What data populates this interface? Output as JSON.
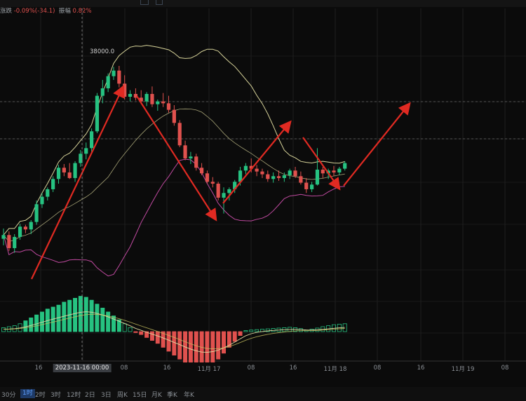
{
  "stats": {
    "change_label": "涨跌",
    "change_value": "-0.09%(-34.1)",
    "amplitude_label": "振幅",
    "amplitude_value": "0.82%"
  },
  "price_marker": "38000.0",
  "x_axis": {
    "ticks": [
      "16",
      "2023-11-16 00:00",
      "08",
      "16",
      "11月 17",
      "08",
      "16",
      "11月 18",
      "08",
      "16",
      "11月 19",
      "08"
    ],
    "highlighted": "2023-11-16 00:00"
  },
  "periods": [
    {
      "label": "30分",
      "active": false
    },
    {
      "label": "1时",
      "active": true
    },
    {
      "label": "2时",
      "active": false
    },
    {
      "label": "3时",
      "active": false
    },
    {
      "label": "12时",
      "active": false
    },
    {
      "label": "2日",
      "active": false
    },
    {
      "label": "3日",
      "active": false
    },
    {
      "label": "周K",
      "active": false
    },
    {
      "label": "15日",
      "active": false
    },
    {
      "label": "月K",
      "active": false
    },
    {
      "label": "季K",
      "active": false
    },
    {
      "label": "年K",
      "active": false
    }
  ],
  "colors": {
    "up": "#26c281",
    "down": "#e0514e",
    "ma": "#d8d49a",
    "boll_upper": "#d8d49a",
    "boll_lower": "#c04aa0",
    "arrow": "#e02a22",
    "dif": "#e0d8a0",
    "dea": "#c8c060"
  },
  "chart_data": {
    "type": "candlestick",
    "interval": "1h",
    "high_marker": 38000.0,
    "candles": [
      [
        36150,
        36260,
        36080,
        36190
      ],
      [
        36190,
        36230,
        36020,
        36050
      ],
      [
        36050,
        36200,
        36000,
        36170
      ],
      [
        36170,
        36310,
        36140,
        36280
      ],
      [
        36280,
        36300,
        36210,
        36250
      ],
      [
        36250,
        36350,
        36200,
        36330
      ],
      [
        36330,
        36560,
        36300,
        36520
      ],
      [
        36520,
        36640,
        36480,
        36600
      ],
      [
        36600,
        36700,
        36560,
        36680
      ],
      [
        36680,
        36820,
        36650,
        36790
      ],
      [
        36790,
        36940,
        36740,
        36910
      ],
      [
        36910,
        36950,
        36820,
        36860
      ],
      [
        36860,
        36960,
        36790,
        36800
      ],
      [
        36800,
        36980,
        36760,
        36960
      ],
      [
        36960,
        37100,
        36920,
        37060
      ],
      [
        37060,
        37180,
        37000,
        37120
      ],
      [
        37120,
        37330,
        37080,
        37300
      ],
      [
        37300,
        37710,
        37280,
        37680
      ],
      [
        37680,
        37850,
        37600,
        37760
      ],
      [
        37760,
        37920,
        37720,
        37890
      ],
      [
        37890,
        37990,
        37850,
        37950
      ],
      [
        37950,
        38000,
        37770,
        37810
      ],
      [
        37810,
        37900,
        37640,
        37670
      ],
      [
        37670,
        37740,
        37620,
        37700
      ],
      [
        37700,
        37760,
        37630,
        37660
      ],
      [
        37660,
        37740,
        37600,
        37620
      ],
      [
        37620,
        37720,
        37570,
        37700
      ],
      [
        37700,
        37780,
        37560,
        37590
      ],
      [
        37590,
        37640,
        37520,
        37620
      ],
      [
        37620,
        37710,
        37560,
        37600
      ],
      [
        37600,
        37680,
        37500,
        37530
      ],
      [
        37530,
        37580,
        37360,
        37390
      ],
      [
        37390,
        37420,
        37130,
        37150
      ],
      [
        37150,
        37200,
        36990,
        37010
      ],
      [
        37010,
        37080,
        36950,
        37030
      ],
      [
        37030,
        37060,
        36880,
        36910
      ],
      [
        36910,
        36960,
        36830,
        36850
      ],
      [
        36850,
        36880,
        36740,
        36760
      ],
      [
        36760,
        36810,
        36700,
        36740
      ],
      [
        36740,
        36760,
        36560,
        36590
      ],
      [
        36590,
        36700,
        36420,
        36640
      ],
      [
        36640,
        36700,
        36560,
        36680
      ],
      [
        36680,
        36780,
        36640,
        36760
      ],
      [
        36760,
        36920,
        36720,
        36880
      ],
      [
        36880,
        36960,
        36840,
        36930
      ],
      [
        36930,
        37010,
        36860,
        36900
      ],
      [
        36900,
        36940,
        36820,
        36870
      ],
      [
        36870,
        36900,
        36800,
        36840
      ],
      [
        36840,
        36880,
        36760,
        36790
      ],
      [
        36790,
        36860,
        36750,
        36820
      ],
      [
        36820,
        36880,
        36770,
        36800
      ],
      [
        36800,
        36860,
        36760,
        36830
      ],
      [
        36830,
        36900,
        36790,
        36880
      ],
      [
        36880,
        36920,
        36800,
        36820
      ],
      [
        36820,
        36870,
        36730,
        36750
      ],
      [
        36750,
        36800,
        36640,
        36680
      ],
      [
        36680,
        36760,
        36650,
        36730
      ],
      [
        36730,
        37120,
        36720,
        36890
      ],
      [
        36890,
        36920,
        36800,
        36850
      ],
      [
        36850,
        36900,
        36790,
        36880
      ],
      [
        36880,
        36930,
        36820,
        36860
      ],
      [
        36860,
        36920,
        36830,
        36900
      ],
      [
        36900,
        36980,
        36880,
        36960
      ]
    ],
    "macd_hist": [
      20,
      25,
      30,
      40,
      55,
      70,
      85,
      100,
      115,
      125,
      135,
      150,
      160,
      170,
      180,
      175,
      160,
      140,
      120,
      100,
      80,
      60,
      40,
      20,
      -5,
      -15,
      -30,
      -45,
      -60,
      -80,
      -100,
      -120,
      -140,
      -160,
      -175,
      -185,
      -190,
      -180,
      -160,
      -140,
      -110,
      -80,
      -50,
      -20,
      5,
      8,
      10,
      12,
      14,
      16,
      18,
      20,
      22,
      20,
      15,
      8,
      12,
      18,
      25,
      30,
      35,
      38,
      40
    ],
    "annotations": [
      "up-arrow",
      "down-arrow",
      "up-arrow",
      "down-arrow",
      "up-arrow"
    ]
  }
}
